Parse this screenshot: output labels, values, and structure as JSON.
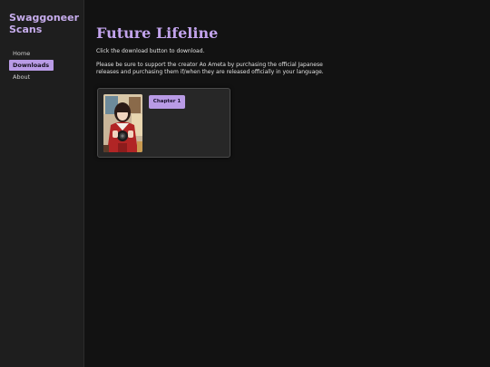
{
  "sidebar": {
    "title": "Swaggoneer Scans",
    "items": [
      {
        "label": "Home"
      },
      {
        "label": "Downloads"
      },
      {
        "label": "About"
      }
    ]
  },
  "main": {
    "title": "Future Lifeline",
    "intro": "Click the download button to download.",
    "notice": "Please be sure to support the creator Ao Ameta by purchasing the official Japanese releases and purchasing them if/when they are released officially in your language.",
    "releases": [
      {
        "button_label": "Chapter 1"
      }
    ]
  },
  "colors": {
    "accent": "#b99be6",
    "title": "#c2a3ec",
    "background": "#121212",
    "sidebar": "#1e1e1e"
  }
}
